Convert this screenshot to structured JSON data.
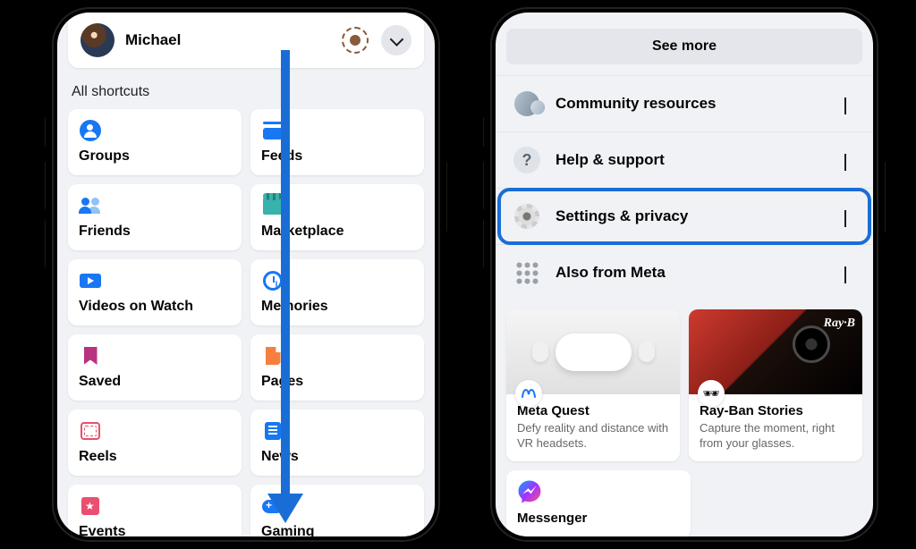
{
  "left": {
    "profile_name": "Michael",
    "section_label": "All shortcuts",
    "shortcuts": [
      {
        "label": "Groups",
        "icon": "groups"
      },
      {
        "label": "Feeds",
        "icon": "feeds"
      },
      {
        "label": "Friends",
        "icon": "friends"
      },
      {
        "label": "Marketplace",
        "icon": "marketplace"
      },
      {
        "label": "Videos on Watch",
        "icon": "video"
      },
      {
        "label": "Memories",
        "icon": "memories"
      },
      {
        "label": "Saved",
        "icon": "saved"
      },
      {
        "label": "Pages",
        "icon": "pages"
      },
      {
        "label": "Reels",
        "icon": "reels"
      },
      {
        "label": "News",
        "icon": "news"
      },
      {
        "label": "Events",
        "icon": "events"
      },
      {
        "label": "Gaming",
        "icon": "gaming"
      }
    ]
  },
  "right": {
    "see_more": "See more",
    "menus": [
      {
        "label": "Community resources",
        "icon": "community",
        "dir": "down"
      },
      {
        "label": "Help & support",
        "icon": "help",
        "dir": "down"
      },
      {
        "label": "Settings & privacy",
        "icon": "settings",
        "dir": "down",
        "highlighted": true
      },
      {
        "label": "Also from Meta",
        "icon": "apps",
        "dir": "up"
      }
    ],
    "meta_cards": [
      {
        "title": "Meta Quest",
        "desc": "Defy reality and distance with VR headsets.",
        "badge": "meta"
      },
      {
        "title": "Ray-Ban Stories",
        "desc": "Capture the moment, right from your glasses.",
        "badge": "glasses"
      }
    ],
    "messenger": {
      "title": "Messenger"
    }
  }
}
